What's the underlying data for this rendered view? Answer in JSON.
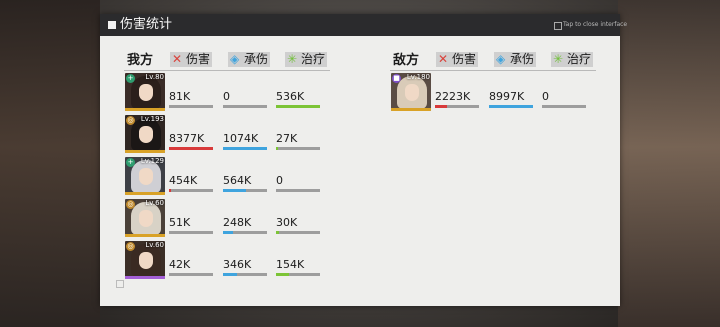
{
  "window": {
    "title": "伤害统计",
    "close_hint": "Tap to close interface"
  },
  "columns": {
    "damage": "伤害",
    "tank": "承伤",
    "heal": "治疗"
  },
  "icons": {
    "damage": "crossed-swords-icon",
    "tank": "shield-icon",
    "heal": "heal-cross-icon"
  },
  "colors": {
    "damage": "#d83a3a",
    "tank": "#3fa4de",
    "heal": "#7cc436",
    "panel": "#eeeeec",
    "titlebar": "#2b2b2d"
  },
  "ally": {
    "label": "我方",
    "units": [
      {
        "level": "80",
        "class_icon": "medic-cross-icon",
        "rarity_color": "#d9a227",
        "damage": "81K",
        "tank": "0",
        "heal": "536K",
        "dmg_ratio": 0.01,
        "tank_ratio": 0.0,
        "heal_ratio": 1.0
      },
      {
        "level": "193",
        "class_icon": "rifle-icon",
        "rarity_color": "#d9a227",
        "damage": "8377K",
        "tank": "1074K",
        "heal": "27K",
        "dmg_ratio": 1.0,
        "tank_ratio": 1.0,
        "heal_ratio": 0.05
      },
      {
        "level": "129",
        "class_icon": "medic-cross-icon",
        "rarity_color": "#d9a227",
        "damage": "454K",
        "tank": "564K",
        "heal": "0",
        "dmg_ratio": 0.05,
        "tank_ratio": 0.53,
        "heal_ratio": 0.0
      },
      {
        "level": "60",
        "class_icon": "rifle-icon",
        "rarity_color": "#d9a227",
        "damage": "51K",
        "tank": "248K",
        "heal": "30K",
        "dmg_ratio": 0.01,
        "tank_ratio": 0.23,
        "heal_ratio": 0.06
      },
      {
        "level": "60",
        "class_icon": "rifle-icon",
        "rarity_color": "#a45fd6",
        "damage": "42K",
        "tank": "346K",
        "heal": "154K",
        "dmg_ratio": 0.01,
        "tank_ratio": 0.32,
        "heal_ratio": 0.29
      }
    ]
  },
  "enemy": {
    "label": "敌方",
    "units": [
      {
        "level": "180",
        "class_icon": "boss-icon",
        "rarity_color": "#d9a227",
        "damage": "2223K",
        "tank": "8997K",
        "heal": "0",
        "dmg_ratio": 0.27,
        "tank_ratio": 1.0,
        "heal_ratio": 0.0
      }
    ]
  }
}
